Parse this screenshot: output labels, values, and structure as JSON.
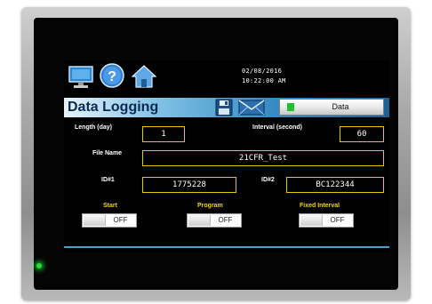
{
  "header": {
    "date": "02/08/2016",
    "time": "10:22:00 AM",
    "icons": [
      "monitor-icon",
      "help-icon",
      "home-icon",
      "save-icon",
      "mail-icon"
    ]
  },
  "title": "Data Logging",
  "data_button": {
    "label": "Data",
    "indicator_color": "#19c229"
  },
  "fields": {
    "length": {
      "label": "Length (day)",
      "value": "1"
    },
    "interval": {
      "label": "Interval (second)",
      "value": "60"
    },
    "file_name": {
      "label": "File Name",
      "value": "21CFR_Test"
    },
    "id1": {
      "label": "ID#1",
      "value": "1775228"
    },
    "id2": {
      "label": "ID#2",
      "value": "BC122344"
    }
  },
  "toggles": {
    "start": {
      "label": "Start",
      "state": "OFF"
    },
    "program": {
      "label": "Program",
      "state": "OFF"
    },
    "fixed_interval": {
      "label": "Fixed Interval",
      "state": "OFF"
    }
  },
  "colors": {
    "field_border": "#e6c800",
    "toggle_label": "#f5d300",
    "title_bar_dark": "#1f5f92",
    "title_bar_light": "#e6f3fb",
    "power_led": "#22dd33"
  }
}
